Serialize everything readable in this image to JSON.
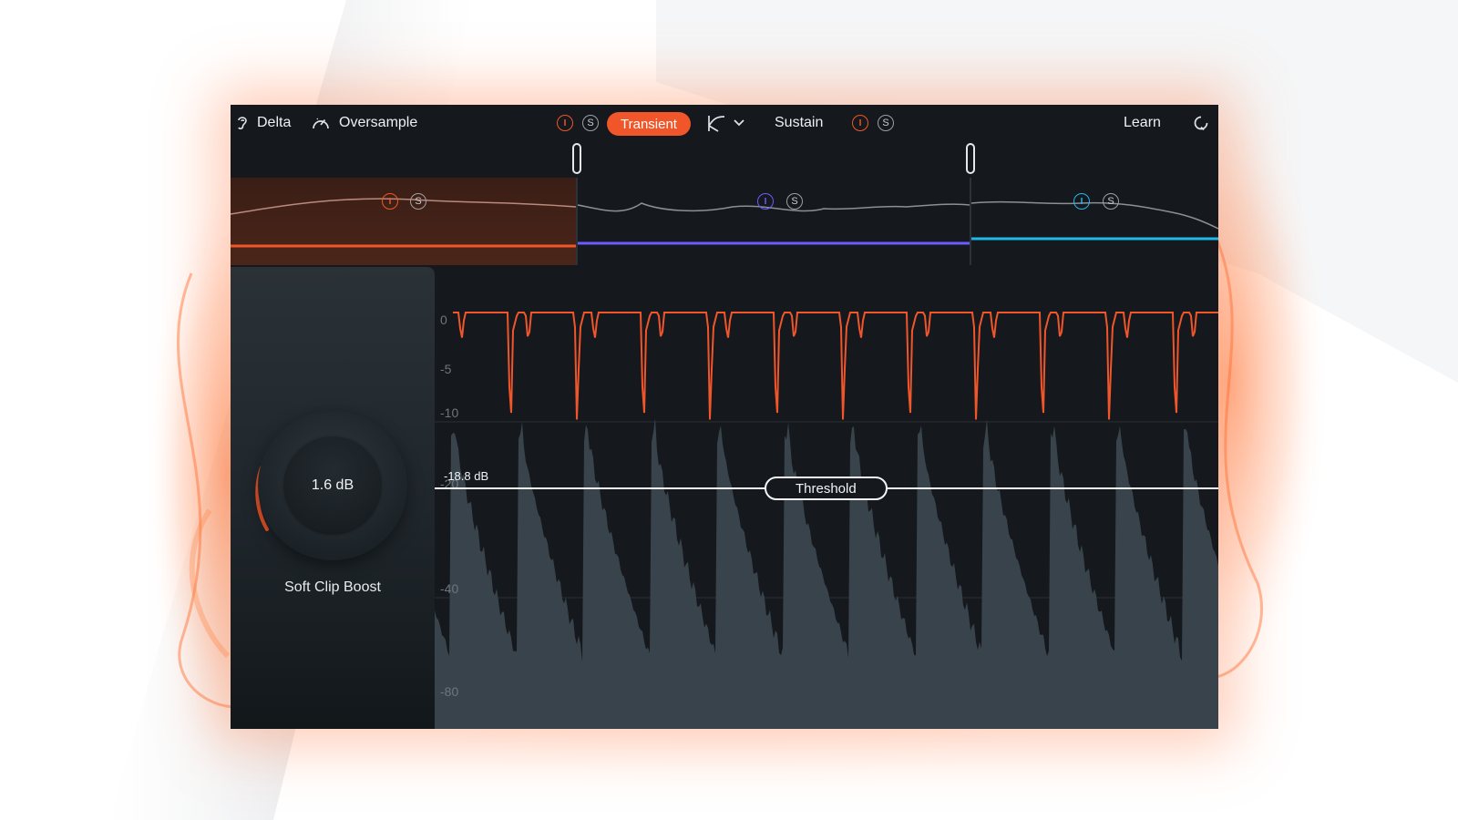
{
  "toolbar": {
    "delta_label": "Delta",
    "oversample_label": "Oversample",
    "transient_label": "Transient",
    "sustain_label": "Sustain",
    "learn_label": "Learn",
    "bypass_symbol": "I",
    "solo_symbol": "S",
    "icons": [
      "ear-icon",
      "gauge-icon",
      "curve-icon",
      "chevron-down-icon",
      "reset-icon"
    ]
  },
  "bands": [
    {
      "name": "low",
      "color": "#f0562a"
    },
    {
      "name": "mid",
      "color": "#6a5cff"
    },
    {
      "name": "high",
      "color": "#1fb8e8"
    }
  ],
  "knob": {
    "value": "1.6 dB",
    "label": "Soft Clip Boost"
  },
  "graph": {
    "axis_labels": [
      "0",
      "-5",
      "-10",
      "-20",
      "-40",
      "-80"
    ],
    "threshold_value": "-18.8 dB",
    "threshold_label": "Threshold"
  },
  "colors": {
    "accent": "#f0562a",
    "background": "#15181c",
    "waveform_fill": "#3a464e"
  }
}
